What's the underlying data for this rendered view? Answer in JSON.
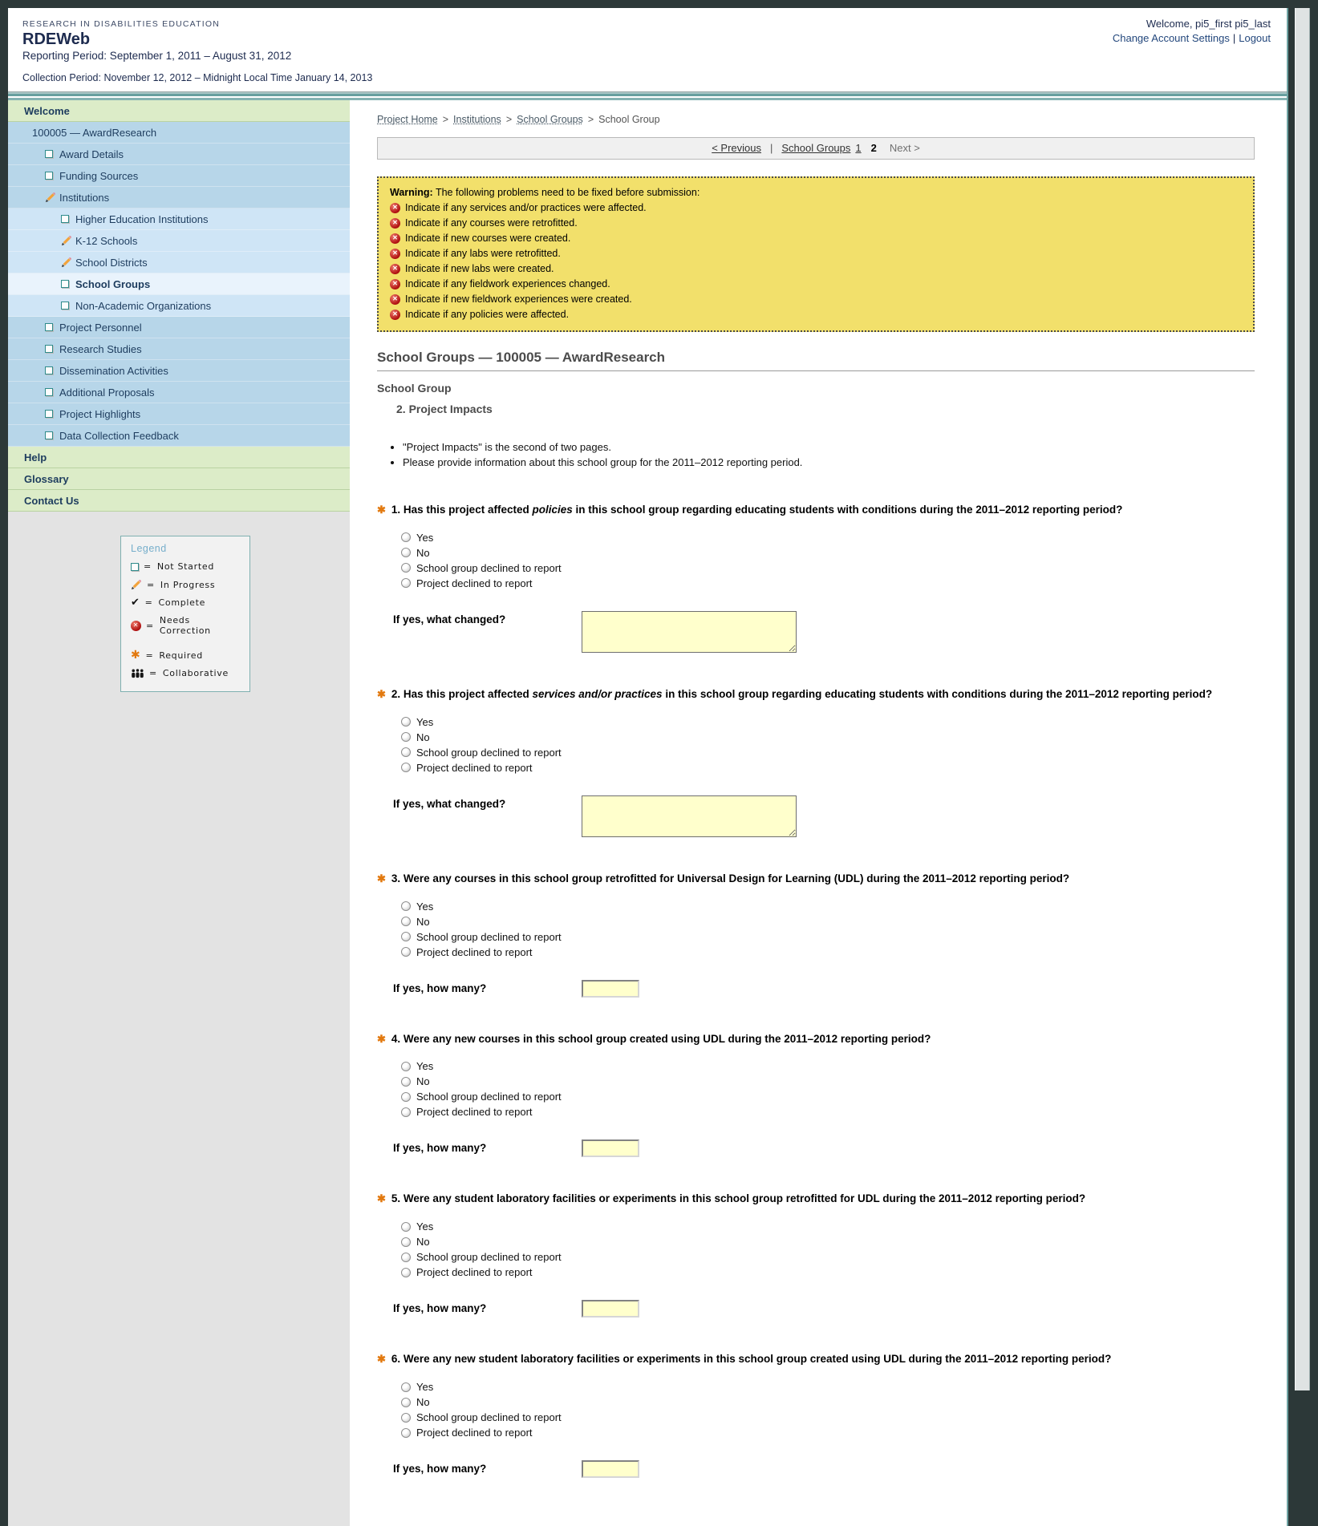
{
  "header": {
    "eyebrow": "RESEARCH IN DISABILITIES EDUCATION",
    "app_title": "RDEWeb",
    "reporting_period": "Reporting Period: September 1, 2011 – August 31, 2012",
    "collection_period": "Collection Period: November 12, 2012 – Midnight Local Time January 14, 2013",
    "welcome_user": "Welcome, pi5_first pi5_last",
    "account_settings_label": "Change Account Settings",
    "links_separator": "|",
    "logout_label": "Logout"
  },
  "sidebar": {
    "items": [
      {
        "label": "Welcome",
        "variant": "green",
        "icon": ""
      },
      {
        "label": "100005 — AwardResearch",
        "variant": "project",
        "icon": ""
      },
      {
        "label": "Award Details",
        "variant": "l1",
        "icon": "notstarted"
      },
      {
        "label": "Funding Sources",
        "variant": "l1",
        "icon": "notstarted"
      },
      {
        "label": "Institutions",
        "variant": "l1",
        "icon": "inprogress"
      },
      {
        "label": "Higher Education Institutions",
        "variant": "l2",
        "icon": "notstarted"
      },
      {
        "label": "K-12 Schools",
        "variant": "l2",
        "icon": "inprogress"
      },
      {
        "label": "School Districts",
        "variant": "l2",
        "icon": "inprogress"
      },
      {
        "label": "School Groups",
        "variant": "l2",
        "icon": "notstarted",
        "selected": true
      },
      {
        "label": "Non-Academic Organizations",
        "variant": "l2",
        "icon": "notstarted"
      },
      {
        "label": "Project Personnel",
        "variant": "l1",
        "icon": "notstarted"
      },
      {
        "label": "Research Studies",
        "variant": "l1",
        "icon": "notstarted"
      },
      {
        "label": "Dissemination Activities",
        "variant": "l1",
        "icon": "notstarted"
      },
      {
        "label": "Additional Proposals",
        "variant": "l1",
        "icon": "notstarted"
      },
      {
        "label": "Project Highlights",
        "variant": "l1",
        "icon": "notstarted"
      },
      {
        "label": "Data Collection Feedback",
        "variant": "l1",
        "icon": "notstarted"
      },
      {
        "label": "Help",
        "variant": "green",
        "icon": ""
      },
      {
        "label": "Glossary",
        "variant": "green",
        "icon": ""
      },
      {
        "label": "Contact Us",
        "variant": "green",
        "icon": ""
      }
    ],
    "legend": {
      "title": "Legend",
      "equals": "=",
      "items": [
        {
          "icon": "notstarted",
          "label": "Not Started"
        },
        {
          "icon": "inprogress",
          "label": "In Progress"
        },
        {
          "icon": "complete",
          "label": "Complete"
        },
        {
          "icon": "needscorrection",
          "label": "Needs Correction"
        },
        {
          "icon": "required",
          "label": "Required",
          "spaced": true
        },
        {
          "icon": "collaborative",
          "label": "Collaborative"
        }
      ]
    }
  },
  "breadcrumb": {
    "links": [
      "Project Home",
      "Institutions",
      "School Groups"
    ],
    "separator": ">",
    "current": "School Group"
  },
  "pagination": {
    "previous_label": "< Previous",
    "separator": "|",
    "section_label": "School Groups",
    "pages": [
      {
        "label": "1",
        "current": false
      },
      {
        "label": "2",
        "current": true
      }
    ],
    "next_label": "Next >"
  },
  "warning": {
    "title": "Warning:",
    "intro": "The following problems need to be fixed before submission:",
    "items": [
      "Indicate if any services and/or practices were affected.",
      "Indicate if any courses were retrofitted.",
      "Indicate if new courses were created.",
      "Indicate if any labs were retrofitted.",
      "Indicate if new labs were created.",
      "Indicate if any fieldwork experiences changed.",
      "Indicate if new fieldwork experiences were created.",
      "Indicate if any policies were affected."
    ]
  },
  "main": {
    "heading": "School Groups — 100005 — AwardResearch",
    "subheading": "School Group",
    "section_title": "2. Project Impacts",
    "notes": [
      "\"Project Impacts\" is the second of two pages.",
      "Please provide information about this school group for the 2011–2012 reporting period."
    ],
    "required_marker": "✱",
    "option_labels": [
      "Yes",
      "No",
      "School group declined to report",
      "Project declined to report"
    ],
    "questions": [
      {
        "lead": "1. Has this project affected",
        "em": "policies",
        "tail": "in this school group regarding educating students with conditions during the 2011–2012 reporting period?",
        "followup_label": "If yes, what changed?",
        "followup_type": "textarea",
        "followup_value": ""
      },
      {
        "lead": "2. Has this project affected",
        "em": "services and/or practices",
        "tail": "in this school group regarding educating students with conditions during the 2011–2012 reporting period?",
        "followup_label": "If yes, what changed?",
        "followup_type": "textarea",
        "followup_value": ""
      },
      {
        "lead": "3. Were any courses in this school group retrofitted for Universal Design for Learning (UDL) during the 2011–2012 reporting period?",
        "em": "",
        "tail": "",
        "followup_label": "If yes, how many?",
        "followup_type": "text",
        "followup_value": ""
      },
      {
        "lead": "4. Were any new courses in this school group created using UDL during the 2011–2012 reporting period?",
        "em": "",
        "tail": "",
        "followup_label": "If yes, how many?",
        "followup_type": "text",
        "followup_value": ""
      },
      {
        "lead": "5. Were any student laboratory facilities or experiments in this school group retrofitted for UDL during the 2011–2012 reporting period?",
        "em": "",
        "tail": "",
        "followup_label": "If yes, how many?",
        "followup_type": "text",
        "followup_value": ""
      },
      {
        "lead": "6. Were any new student laboratory facilities or experiments in this school group created using UDL during the 2011–2012 reporting period?",
        "em": "",
        "tail": "",
        "followup_label": "If yes, how many?",
        "followup_type": "text",
        "followup_value": ""
      }
    ],
    "colors": {
      "accent_teal": "#679f9f",
      "sidebar_green": "#dcecc8",
      "sidebar_blue": "#b7d6e9",
      "sidebar_blue_light": "#cfe5f6",
      "warning_yellow": "#f2e06b",
      "field_yellow": "#ffffcc",
      "required_orange": "#e2790f",
      "error_red": "#b01010"
    }
  }
}
